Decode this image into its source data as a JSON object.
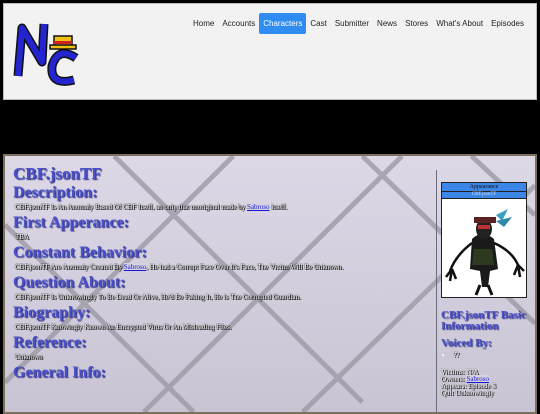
{
  "site": {
    "logo_text": "NC"
  },
  "nav": [
    {
      "label": "Home",
      "active": false
    },
    {
      "label": "Accounts",
      "active": false
    },
    {
      "label": "Characters",
      "active": true
    },
    {
      "label": "Cast",
      "active": false
    },
    {
      "label": "Submitter",
      "active": false
    },
    {
      "label": "News",
      "active": false
    },
    {
      "label": "Stores",
      "active": false
    },
    {
      "label": "What's About",
      "active": false
    },
    {
      "label": "Episodes",
      "active": false
    }
  ],
  "page": {
    "title": "CBF.jsonTF",
    "sections": [
      {
        "heading": "Description:",
        "text": "CBF.jsonTF Is An Anomaly Based Of CBF Itself, an only that unoriginal made by ",
        "link": "Sabroso",
        "after": " itself."
      },
      {
        "heading": "First Apperance:",
        "text": "TBA"
      },
      {
        "heading": "Constant Behavior:",
        "text": "CBF.jsonTF Are Anomaly Created By ",
        "link": "Sabroso",
        "after": ", He had a Corrupt Face Over It's Face, The Victim Will Be Unknown."
      },
      {
        "heading": "Question About:",
        "text": "CBF.jsonTF Is Unknowingly To Be Dead Or Alive, He'd Be Faking It, He is The Corrupted Guardian."
      },
      {
        "heading": "Biography:",
        "text": "CBF.jsonTF Knowingly Known An Encrypted Virus Or An Misleading Files."
      },
      {
        "heading": "Reference:",
        "text": "Unknown"
      },
      {
        "heading": "General Info:",
        "text": ""
      }
    ]
  },
  "sidebar": {
    "appearance_label": "Appearance",
    "appearance_sub": "CBF.jsonTF",
    "basic_info": "CBF.jsonTF Basic Information",
    "voiced_by": "Voiced By:",
    "voiced_value": "??",
    "victims": "Victims: N/A",
    "owners_label": "Owners: ",
    "owners_link": "Sabroso",
    "appears": "Appears: Episode 3",
    "quit": "Quit Unknowingly"
  },
  "colors": {
    "accent": "#2f8cf0",
    "heading": "#4b50c8",
    "link": "#1818d8"
  }
}
